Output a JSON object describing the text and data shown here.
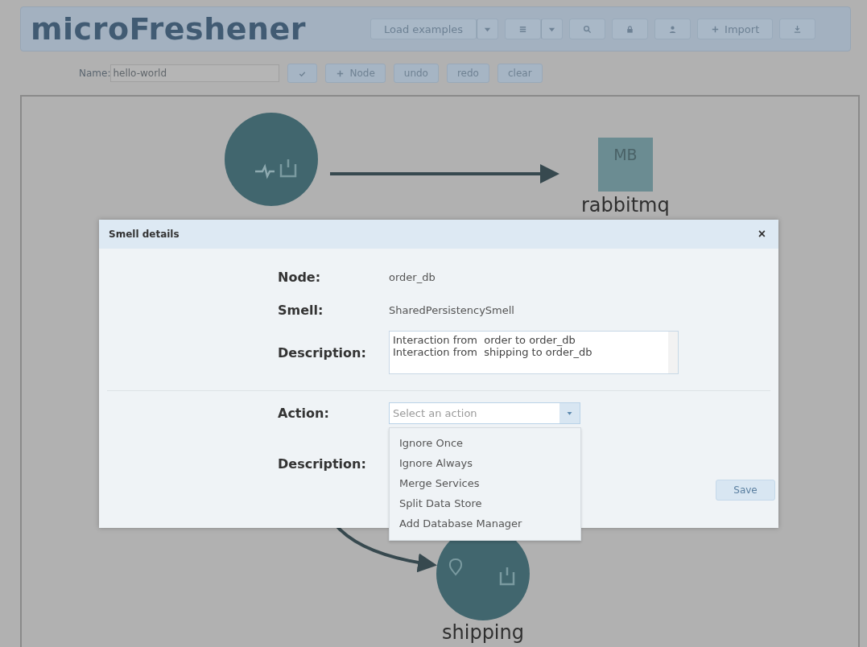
{
  "app": {
    "title": "microFreshener"
  },
  "header_controls": [
    {
      "kind": "text",
      "label": "Load examples",
      "caret": true
    },
    {
      "kind": "list",
      "caret": true
    },
    {
      "kind": "search",
      "caret": false
    },
    {
      "kind": "lock",
      "caret": false
    },
    {
      "kind": "user",
      "caret": false
    },
    {
      "kind": "import",
      "label": "Import",
      "caret": false
    },
    {
      "kind": "download",
      "caret": false
    }
  ],
  "toolbar": {
    "name_label": "Name:",
    "name_value": "hello-world",
    "buttons": [
      {
        "kind": "check"
      },
      {
        "kind": "add",
        "label": "Node"
      },
      {
        "kind": "text",
        "label": "undo"
      },
      {
        "kind": "text",
        "label": "redo"
      },
      {
        "kind": "text",
        "label": "clear"
      }
    ]
  },
  "graph": {
    "nodes": [
      {
        "kind": "service"
      },
      {
        "kind": "broker",
        "badge": "MB",
        "label": "rabbitmq"
      },
      {
        "kind": "pinservice",
        "label": "shipping"
      }
    ]
  },
  "dialog": {
    "title": "Smell details",
    "close": "×",
    "fields": [
      {
        "kind": "text",
        "label": "Node:",
        "value": "order_db"
      },
      {
        "kind": "text",
        "label": "Smell:",
        "value": "SharedPersistencySmell"
      },
      {
        "kind": "textarea",
        "label": "Description:",
        "lines": [
          "Interaction from  order to order_db",
          "Interaction from  shipping to order_db"
        ]
      }
    ],
    "action": {
      "label": "Action:",
      "placeholder": "Select an action",
      "expanded": true,
      "options": [
        {
          "label": "Ignore Once",
          "selected": false
        },
        {
          "label": "Ignore Always",
          "selected": false
        },
        {
          "label": "Merge Services",
          "selected": false
        },
        {
          "label": "Split Data Store",
          "selected": false
        },
        {
          "label": "Add Database Manager",
          "selected": false
        }
      ]
    },
    "description_label": "Description:",
    "save": "Save"
  }
}
